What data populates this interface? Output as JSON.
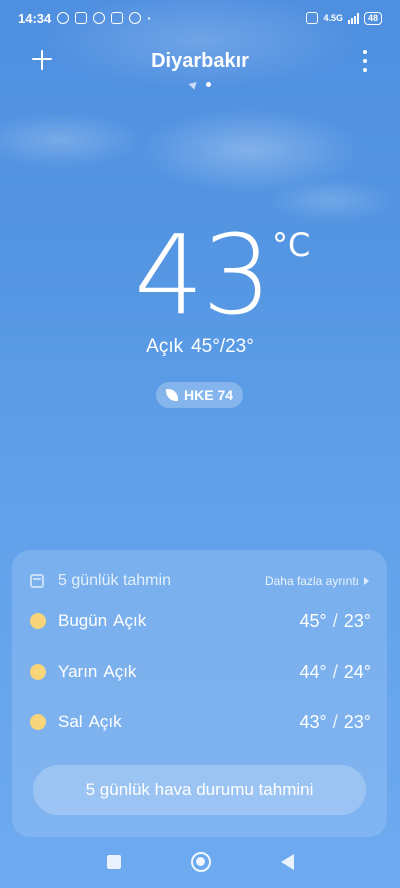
{
  "status_bar": {
    "time": "14:34",
    "network": "4.5G",
    "battery": "48",
    "icons": [
      "alarm-icon",
      "nfc-icon",
      "chat-icon",
      "navigation-icon",
      "circle-app-icon",
      "dot-icon",
      "vowifi-icon",
      "signal-icon",
      "battery-icon"
    ]
  },
  "header": {
    "city": "Diyarbakır",
    "add_icon": "plus-icon",
    "menu_icon": "more-vertical-icon"
  },
  "current": {
    "temperature": "43",
    "unit": "°C",
    "condition": "Açık",
    "high_low": "45°/23°",
    "aqi_label": "HKE 74"
  },
  "forecast": {
    "title": "5 günlük tahmin",
    "more_label": "Daha fazla ayrıntı",
    "days": [
      {
        "day": "Bugün",
        "condition": "Açık",
        "high": "45°",
        "low": "23°"
      },
      {
        "day": "Yarın",
        "condition": "Açık",
        "high": "44°",
        "low": "24°"
      },
      {
        "day": "Sal",
        "condition": "Açık",
        "high": "43°",
        "low": "23°"
      }
    ],
    "separator": "/",
    "cta_label": "5 günlük hava durumu tahmini"
  },
  "colors": {
    "sky_top": "#4f8fe0",
    "sky_bottom": "#6eaaf0",
    "sun": "#f8d57a"
  }
}
